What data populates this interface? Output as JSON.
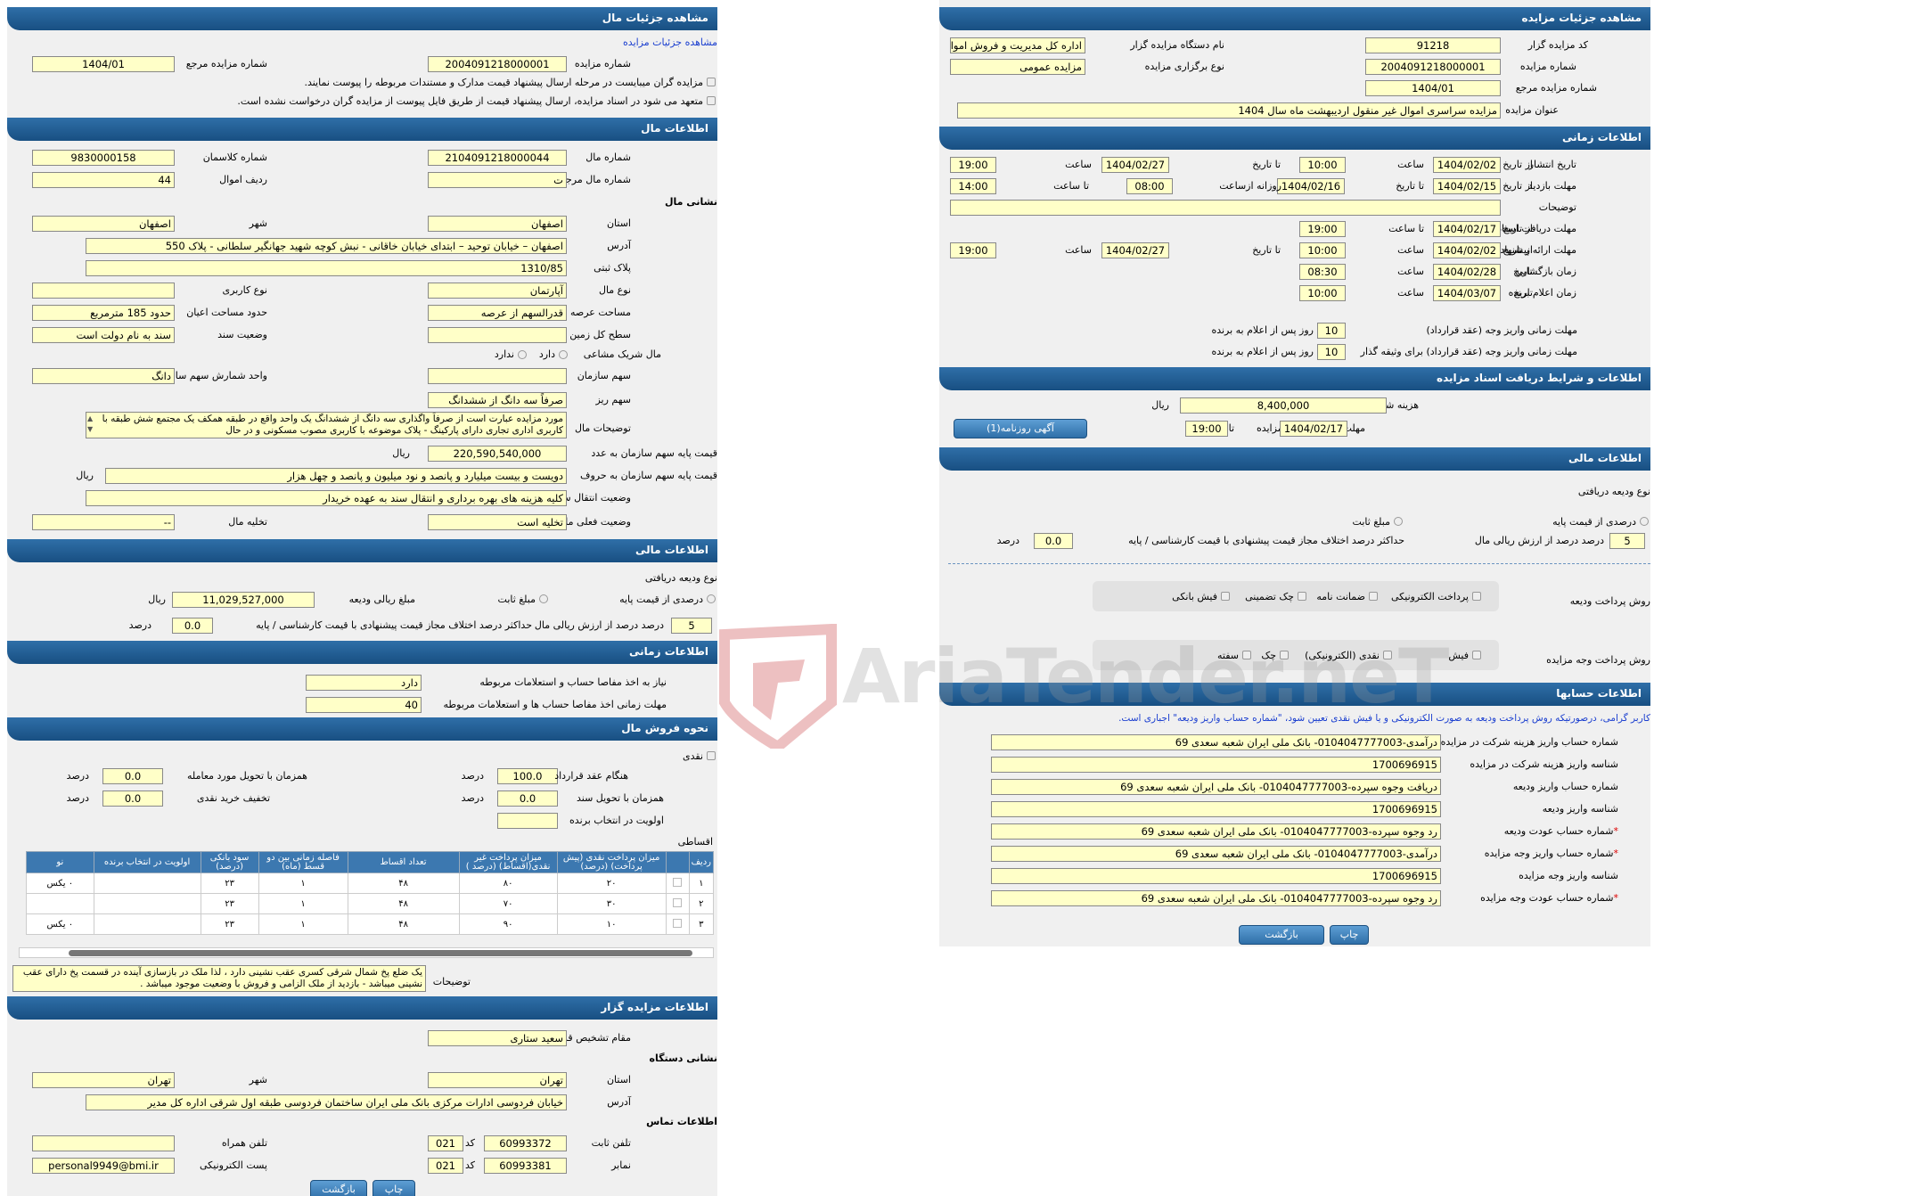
{
  "left": {
    "h_details": "مشاهده جزئیات مال",
    "link_auction": "مشاهده جزئیات مزایده",
    "lbl_auction_no": "شماره مزایده",
    "auction_no": "2004091218000001",
    "lbl_ref_no": "شماره مزایده مرجع",
    "ref_no": "1404/01",
    "c1": "مزایده گران میبایست در مرحله ارسال پیشنهاد قیمت مدارک و مستندات مربوطه را پیوست نمایند.",
    "c2": "متعهد می شود در اسناد مزایده، ارسال پیشنهاد قیمت از طریق فایل پیوست از مزایده گران درخواست نشده است.",
    "h_goods": "اطلاعات مال",
    "lbl_goods_no": "شماره مال",
    "goods_no": "2104091218000044",
    "lbl_class_no": "شماره کلاسمان",
    "class_no": "9830000158",
    "lbl_goods_ref": "شماره مال مرجع",
    "goods_ref": "ت",
    "lbl_row": "ردیف اموال",
    "row": "44",
    "h_addr": "نشانی مال",
    "lbl_province": "استان",
    "province": "اصفهان",
    "lbl_city": "شهر",
    "city": "اصفهان",
    "lbl_address": "آدرس",
    "address": "اصفهان – خیابان توحید – ابتدای خیابان خاقانی - نبش کوچه شهید جهانگیر سلطانی - پلاک 550",
    "lbl_plate": "پلاک ثبتی",
    "plate": "1310/85",
    "lbl_type": "نوع مال",
    "type": "آپارتمان",
    "lbl_usage": "نوع کاربری",
    "usage": "",
    "lbl_area": "مساحت عرصه",
    "area": "قدرالسهم از عرصه",
    "lbl_bldg": "حدود مساحت اعیان",
    "bldg": "حدود 185 مترمربع",
    "lbl_level": "سطح کل زمین",
    "level": "",
    "lbl_doc": "وضعیت سند",
    "doc": "سند به نام دولت است",
    "lbl_partner": "مال شریک مشاعی",
    "opt_has": "دارد",
    "opt_hasnot": "ندارد",
    "lbl_share": "سهم سازمان",
    "share": "",
    "lbl_unit": "واحد شمارش سهم سازمان",
    "unit": "دانگ",
    "lbl_minor": "سهم ریز",
    "minor": "صرفاً سه دانگ از ششدانگ",
    "lbl_desc": "توضیحات مال",
    "desc": "مورد مزایده عبارت است از صرفاً واگذاری سه دانگ از ششدانگ یک واحد واقع در طبقه همکف یک مجتمع شش طبقه با کاربری اداری تجاری دارای پارکینگ - پلاک موضوعه با کاربری مصوب مسکونی و در حال",
    "lbl_base_num": "قیمت پایه سهم سازمان به عدد",
    "base_num": "220,590,540,000",
    "rial": "ریال",
    "lbl_base_txt": "قیمت پایه سهم سازمان به حروف",
    "base_txt": "دویست و بیست میلیارد و پانصد و نود میلیون و پانصد و چهل هزار",
    "lbl_transfer": "وضعیت انتقال سند",
    "transfer": "کلیه هزینه های بهره برداری و انتقال سند به عهده خریدار",
    "lbl_actual": "وضعیت فعلی مال",
    "actual": "تخلیه است",
    "lbl_evict": "تخلیه مال",
    "evict": "--",
    "h_fin": "اطلاعات مالی",
    "lbl_dep_type": "نوع ودیعه دریافتی",
    "lbl_pct": "درصدی از قیمت پایه",
    "lbl_fixed": "مبلغ ثابت",
    "lbl_dep_amt": "مبلغ ریالی ودیعه",
    "dep_amt": "11,029,527,000",
    "lbl_pct_val": "درصد از ارزش ریالی مال",
    "pct_val": "5",
    "pct_unit": "درصد",
    "lbl_max_diff": "حداکثر درصد اختلاف مجاز قیمت پیشنهادی با قیمت کارشناسی / پایه",
    "max_diff": "0.0",
    "h_time": "اطلاعات زمانی",
    "lbl_need": "نیاز به اخذ مفاصا حساب و استعلامات مربوطه",
    "need": "دارد",
    "lbl_need_days": "مهلت زمانی اخذ مفاصا حساب ها و استعلامات مربوطه",
    "need_days": "40",
    "h_sale": "نحوه فروش مال",
    "lbl_cash": "نقدی",
    "lbl_contract": "هنگام عقد قرارداد",
    "contract": "100.0",
    "lbl_deliver": "همزمان با تحویل مورد معامله",
    "deliver": "0.0",
    "lbl_doc_deliver": "همزمان با تحویل سند",
    "doc_deliver": "0.0",
    "lbl_discount": "تخفیف خرید نقدی",
    "discount": "0.0",
    "lbl_priority": "اولویت در انتخاب برنده",
    "priority": "",
    "lbl_install": "اقساطی",
    "th": [
      "ردیف",
      "",
      "میزان پرداخت نقدی (پیش پرداخت) (درصد)",
      "میزان پرداخت غیر نقدی(اقساط) (درصد )",
      "تعداد اقساط",
      "فاصله زمانی بین دو قسط (ماه)",
      "سود بانکی (درصد)",
      "اولویت در انتخاب برنده",
      "نو"
    ],
    "rows": [
      [
        "۱",
        "",
        "۲۰",
        "۸۰",
        "۴۸",
        "۱",
        "۲۳",
        "",
        "۰ یکس"
      ],
      [
        "۲",
        "",
        "۳۰",
        "۷۰",
        "۴۸",
        "۱",
        "۲۳",
        "",
        ""
      ],
      [
        "۳",
        "",
        "۱۰",
        "۹۰",
        "۴۸",
        "۱",
        "۲۳",
        "",
        "۰ یکس"
      ]
    ],
    "lbl_notes": "توضیحات",
    "notes": "یک ضلع پخ شمال شرقی کسری عقب نشینی دارد ، لذا ملک در بازسازی آینده در قسمت پخ دارای عقب نشینی میباشد - بازدید از ملک الزامی و فروش با وضعیت موجود میباشد .",
    "h_org": "اطلاعات مزایده گزار",
    "lbl_authority": "مقام تشخیص قرارداد",
    "authority": "سعید ستاری",
    "h_org_addr": "نشانی دستگاه",
    "lbl_o_prov": "استان",
    "o_prov": "تهران",
    "lbl_o_city": "شهر",
    "o_city": "تهران",
    "lbl_o_addr": "آدرس",
    "o_addr": "خیابان فردوسی ادارات مرکزی بانک ملی ایران ساختمان فردوسی طبقه اول شرقی اداره کل مدیر",
    "h_contact": "اطلاعات تماس",
    "lbl_tel": "تلفن ثابت",
    "tel": "60993372",
    "lbl_code": "کد",
    "code1": "021",
    "lbl_mobile": "تلفن همراه",
    "mobile": "",
    "lbl_fax": "نمابر",
    "fax": "60993381",
    "code2": "021",
    "lbl_email": "پست الکترونیکی",
    "email": "personal9949@bmi.ir",
    "btn_print": "چاپ",
    "btn_back": "بازگشت"
  },
  "right": {
    "h_details": "مشاهده جزئیات مزایده",
    "lbl_code": "کد مزایده گزار",
    "code": "91218",
    "lbl_org": "نام دستگاه مزایده گزار",
    "org": "اداره کل مدیریت و فروش اموال",
    "lbl_no": "شماره مزایده",
    "no": "2004091218000001",
    "lbl_hold": "نوع برگزاری مزایده",
    "hold": "مزایده عمومی",
    "lbl_ref": "شماره مزایده مرجع",
    "ref": "1404/01",
    "lbl_title": "عنوان مزایده",
    "title": "مزایده سراسری اموال غیر منقول اردیبهشت ماه سال 1404",
    "h_time": "اطلاعات زمانی",
    "lbl_pub": "تاریخ انتشار",
    "lbl_from": "از تاریخ",
    "lbl_to": "تا تاریخ",
    "lbl_hour": "ساعت",
    "lbl_to_hour": "تا ساعت",
    "lbl_date": "تاریخ",
    "pub_from": "1404/02/02",
    "pub_from_t": "10:00",
    "pub_to": "1404/02/27",
    "pub_to_t": "19:00",
    "lbl_visit": "مهلت بازدید",
    "visit_from": "1404/02/15",
    "visit_to": "1404/02/16",
    "lbl_daily": "روزانه ازساعت",
    "visit_from_t": "08:00",
    "visit_to_t": "14:00",
    "lbl_notes": "توضیحات",
    "notes": "",
    "lbl_docs": "مهلت دریافت اسناد",
    "docs_from": "1404/02/17",
    "docs_to_t": "19:00",
    "lbl_offer": "مهلت ارائه پیشنهاد",
    "offer_from": "1404/02/02",
    "offer_from_t": "10:00",
    "offer_to": "1404/02/27",
    "offer_to_t": "19:00",
    "lbl_open": "زمان بازگشایی",
    "open": "1404/02/28",
    "open_t": "08:30",
    "lbl_winner": "زمان اعلام برنده",
    "winner": "1404/03/07",
    "winner_t": "10:00",
    "lbl_pay_dead": "مهلت زمانی واریز وجه (عقد قرارداد)",
    "pay_dead": "10",
    "lbl_days_after": "روز پس از اعلام به برنده",
    "lbl_pay_dead2": "مهلت زمانی واریز وجه (عقد قرارداد) برای وثیقه گذار",
    "pay_dead2": "10",
    "h_docs": "اطلاعات و شرایط دریافت اسناد مزایده",
    "lbl_fee": "هزینه شرکت در مزایده (خرید اسناد)",
    "fee": "8,400,000",
    "rial": "ریال",
    "lbl_doc_dead": "مهلت دریافت اسناد مزایده",
    "doc_dead_to": "1404/02/17",
    "doc_dead_t": "19:00",
    "btn_ad": "آگهی روزنامه(1)",
    "h_fin": "اطلاعات مالی",
    "lbl_dep_type": "نوع ودیعه دریافتی",
    "lbl_pct": "درصدی از قیمت پایه",
    "lbl_fixed": "مبلغ ثابت",
    "lbl_pct_val": "درصد از ارزش ریالی مال",
    "pct_val": "5",
    "pct_unit": "درصد",
    "lbl_max": "حداکثر درصد اختلاف مجاز قیمت پیشنهادی با قیمت کارشناسی / پایه",
    "max": "0.0",
    "lbl_dep_method": "روش پرداخت ودیعه",
    "dm": [
      "پرداخت الکترونیکی",
      "ضمانت نامه",
      "چک تضمینی",
      "فیش بانکی"
    ],
    "lbl_pay_method": "روش پرداخت وجه مزایده",
    "pm": [
      "فیش",
      "نقدی (الکترونیکی)",
      "چک",
      "سفته"
    ],
    "h_acc": "اطلاعات حسابها",
    "acc_note": "کاربر گرامی، درصورتیکه روش پرداخت ودیعه به صورت الکترونیکی و یا فیش نقدی تعیین شود، \"شماره حساب واریز ودیعه\" اجباری است.",
    "lbl_a1": "شماره حساب واریز هزینه شرکت در مزایده",
    "a1": "درآمدی-0104047777003- بانک ملی ایران شعبه سعدی 69",
    "lbl_a2": "شناسه واریز هزینه شرکت در مزایده",
    "a2": "1700696915",
    "lbl_a3": "شماره حساب واریز ودیعه",
    "a3": "دریافت وجوه سپرده-0104047777003- بانک ملی ایران شعبه سعدی 69",
    "lbl_a4": "شناسه واریز ودیعه",
    "a4": "1700696915",
    "lbl_a5": "شماره حساب عودت ودیعه",
    "a5": "رد وجوه سپرده-0104047777003- بانک ملی ایران شعبه سعدی 69",
    "lbl_a6": "شماره حساب واریز وجه مزایده",
    "a6": "درآمدی-0104047777003- بانک ملی ایران شعبه سعدی 69",
    "lbl_a7": "شناسه واریز وجه مزایده",
    "a7": "1700696915",
    "lbl_a8": "شماره حساب عودت وجه مزایده",
    "a8": "رد وجوه سپرده-0104047777003- بانک ملی ایران شعبه سعدی 69",
    "req": "*",
    "btn_print": "چاپ",
    "btn_back": "بازگشت"
  },
  "watermark": "AriaTender.neT"
}
